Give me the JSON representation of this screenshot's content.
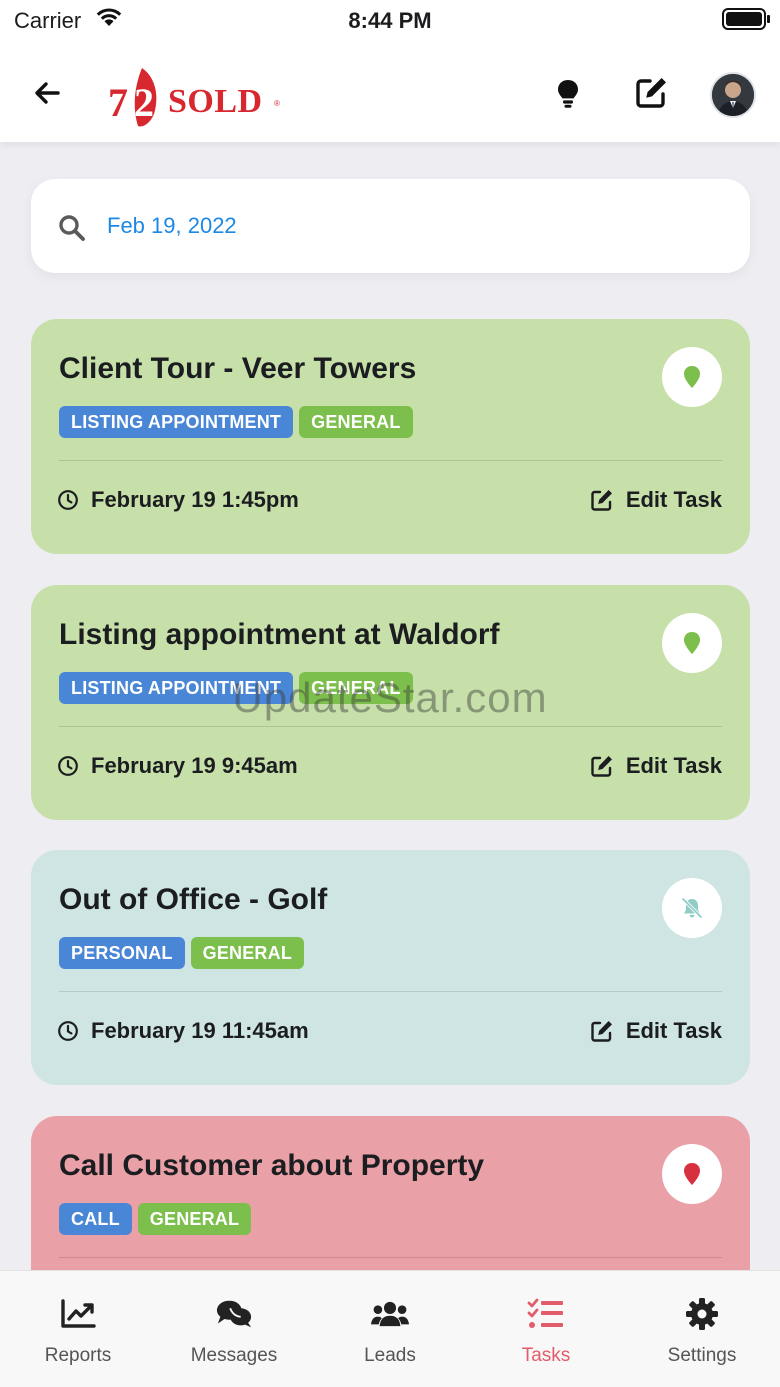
{
  "status_bar": {
    "carrier": "Carrier",
    "time": "8:44 PM"
  },
  "header": {
    "logo_text": "72SOLD"
  },
  "search": {
    "value": "Feb 19, 2022"
  },
  "tasks": [
    {
      "title": "Client Tour - Veer Towers",
      "tags": [
        "LISTING APPOINTMENT",
        "GENERAL"
      ],
      "time": "February 19 1:45pm",
      "edit_label": "Edit Task",
      "color": "#c7e0a9",
      "icon": "map-pin-icon"
    },
    {
      "title": "Listing appointment at Waldorf",
      "tags": [
        "LISTING APPOINTMENT",
        "GENERAL"
      ],
      "time": "February 19 9:45am",
      "edit_label": "Edit Task",
      "color": "#c7e0a9",
      "icon": "map-pin-icon"
    },
    {
      "title": "Out of Office - Golf",
      "tags": [
        "PERSONAL",
        "GENERAL"
      ],
      "time": "February 19 11:45am",
      "edit_label": "Edit Task",
      "color": "#cfe5e3",
      "icon": "bell-slash-icon"
    },
    {
      "title": "Call Customer about Property",
      "tags": [
        "CALL",
        "GENERAL"
      ],
      "color": "#e9a0a7",
      "icon": "map-pin-icon"
    }
  ],
  "watermark": "UpdateStar.com",
  "tab_bar": {
    "items": [
      {
        "label": "Reports",
        "icon": "chart-line-icon"
      },
      {
        "label": "Messages",
        "icon": "comments-icon"
      },
      {
        "label": "Leads",
        "icon": "users-icon"
      },
      {
        "label": "Tasks",
        "icon": "tasks-icon",
        "active": true
      },
      {
        "label": "Settings",
        "icon": "gear-icon"
      }
    ]
  },
  "colors": {
    "accent_blue": "#1e88e5",
    "active_tab": "#e25c6a",
    "tag_blue": "#4a86d6",
    "tag_green": "#7cbf4c"
  }
}
